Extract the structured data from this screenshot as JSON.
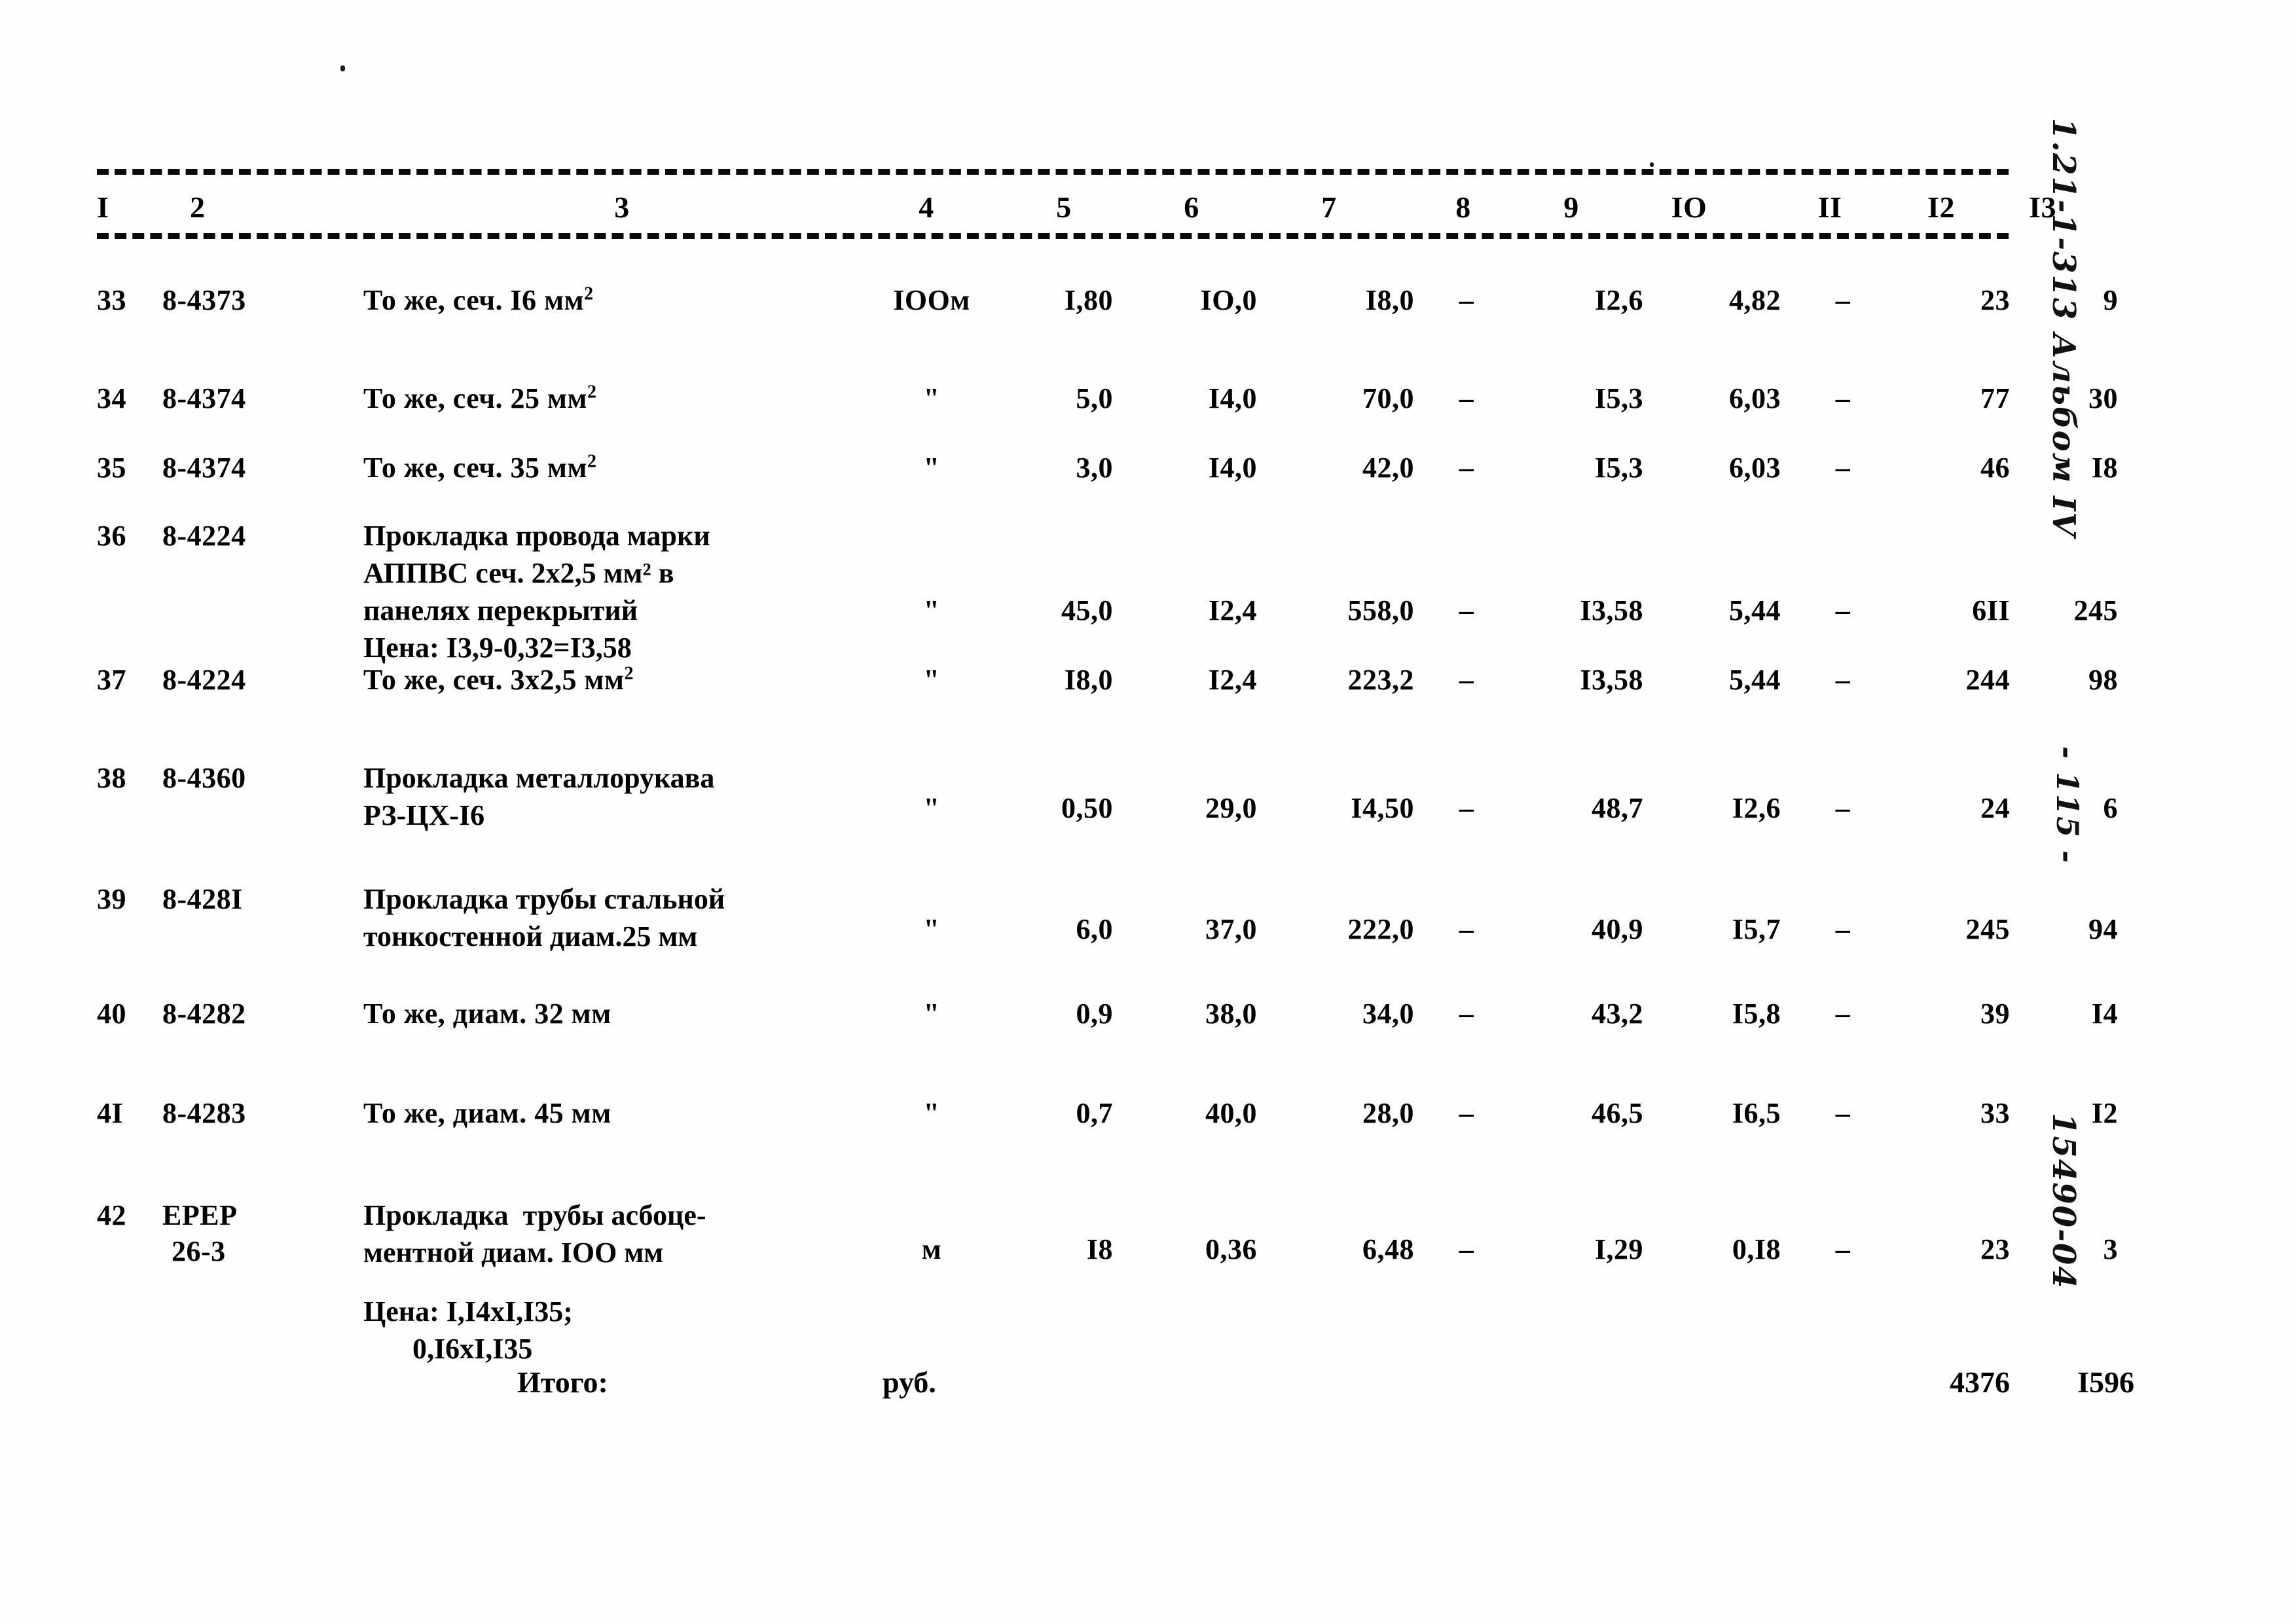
{
  "document": {
    "kind": "scanned-estimate-table",
    "language": "ru"
  },
  "margin_notes": {
    "album": "1.21-1-313 Альбом IV",
    "page": "- 115 -",
    "doc_number": "15490-04"
  },
  "table": {
    "column_headers": [
      "I",
      "2",
      "3",
      "4",
      "5",
      "6",
      "7",
      "8",
      "9",
      "IO",
      "II",
      "I2",
      "I3"
    ],
    "rows": [
      {
        "num": "33",
        "code": "8-4373",
        "desc_lines": [
          "То же, сеч. I6 мм"
        ],
        "desc_sup": "2",
        "unit": "IООм",
        "c5": "I,80",
        "c6": "IО,0",
        "c7": "I8,0",
        "c8": "–",
        "c9": "I2,6",
        "c10": "4,82",
        "c11": "–",
        "c12": "23",
        "c13": "9"
      },
      {
        "num": "34",
        "code": "8-4374",
        "desc_lines": [
          "То же, сеч. 25 мм"
        ],
        "desc_sup": "2",
        "unit": "\"",
        "c5": "5,0",
        "c6": "I4,0",
        "c7": "70,0",
        "c8": "–",
        "c9": "I5,3",
        "c10": "6,03",
        "c11": "–",
        "c12": "77",
        "c13": "30"
      },
      {
        "num": "35",
        "code": "8-4374",
        "desc_lines": [
          "То же, сеч. 35 мм"
        ],
        "desc_sup": "2",
        "unit": "\"",
        "c5": "3,0",
        "c6": "I4,0",
        "c7": "42,0",
        "c8": "–",
        "c9": "I5,3",
        "c10": "6,03",
        "c11": "–",
        "c12": "46",
        "c13": "I8"
      },
      {
        "num": "36",
        "code": "8-4224",
        "desc_lines": [
          "Прокладка провода марки",
          "АППВС сеч. 2х2,5 мм² в",
          "панелях перекрытий",
          "Цена: I3,9-0,32=I3,58"
        ],
        "desc_sup": "",
        "unit": "\"",
        "c5": "45,0",
        "c6": "I2,4",
        "c7": "558,0",
        "c8": "–",
        "c9": "I3,58",
        "c10": "5,44",
        "c11": "–",
        "c12": "6II",
        "c13": "245"
      },
      {
        "num": "37",
        "code": "8-4224",
        "desc_lines": [
          "То же, сеч. 3х2,5 мм"
        ],
        "desc_sup": "2",
        "unit": "\"",
        "c5": "I8,0",
        "c6": "I2,4",
        "c7": "223,2",
        "c8": "–",
        "c9": "I3,58",
        "c10": "5,44",
        "c11": "–",
        "c12": "244",
        "c13": "98"
      },
      {
        "num": "38",
        "code": "8-4360",
        "desc_lines": [
          "Прокладка металлорукава",
          "РЗ-ЦХ-I6"
        ],
        "desc_sup": "",
        "unit": "\"",
        "c5": "0,50",
        "c6": "29,0",
        "c7": "I4,50",
        "c8": "–",
        "c9": "48,7",
        "c10": "I2,6",
        "c11": "–",
        "c12": "24",
        "c13": "6"
      },
      {
        "num": "39",
        "code": "8-428I",
        "desc_lines": [
          "Прокладка трубы стальной",
          "тонкостенной диам.25 мм"
        ],
        "desc_sup": "",
        "unit": "\"",
        "c5": "6,0",
        "c6": "37,0",
        "c7": "222,0",
        "c8": "–",
        "c9": "40,9",
        "c10": "I5,7",
        "c11": "–",
        "c12": "245",
        "c13": "94"
      },
      {
        "num": "40",
        "code": "8-4282",
        "desc_lines": [
          "То же, диам. 32 мм"
        ],
        "desc_sup": "",
        "unit": "\"",
        "c5": "0,9",
        "c6": "38,0",
        "c7": "34,0",
        "c8": "–",
        "c9": "43,2",
        "c10": "I5,8",
        "c11": "–",
        "c12": "39",
        "c13": "I4"
      },
      {
        "num": "4I",
        "code": "8-4283",
        "desc_lines": [
          "То же, диам. 45 мм"
        ],
        "desc_sup": "",
        "unit": "\"",
        "c5": "0,7",
        "c6": "40,0",
        "c7": "28,0",
        "c8": "–",
        "c9": "46,5",
        "c10": "I6,5",
        "c11": "–",
        "c12": "33",
        "c13": "I2"
      },
      {
        "num": "42",
        "code": "ЕРЕР",
        "code2": "26-3",
        "desc_lines": [
          "Прокладка  трубы асбоце-",
          "ментной диам. IОО мм"
        ],
        "desc_sup": "",
        "unit": "м",
        "c5": "I8",
        "c6": "0,36",
        "c7": "6,48",
        "c8": "–",
        "c9": "I,29",
        "c10": "0,I8",
        "c11": "–",
        "c12": "23",
        "c13": "3"
      }
    ],
    "price_note_42": {
      "line1": "Цена: I,I4хI,I35;",
      "line2": "0,I6хI,I35"
    },
    "total": {
      "label": "Итого:",
      "unit": "руб.",
      "c12": "4376",
      "c13": "I596"
    }
  }
}
